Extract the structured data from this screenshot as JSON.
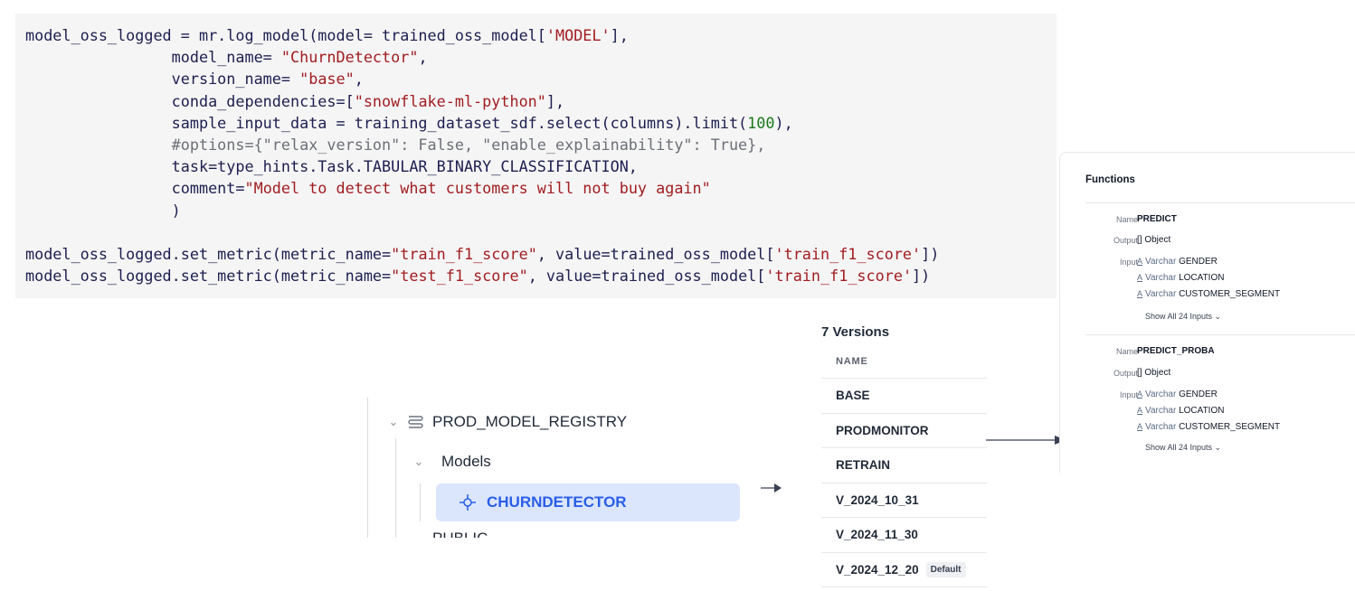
{
  "code": {
    "lines": [
      [
        [
          "plain",
          "model_oss_logged = mr.log_model(model= trained_oss_model["
        ],
        [
          "str",
          "'MODEL'"
        ],
        [
          "plain",
          "],"
        ]
      ],
      [
        [
          "plain",
          "                model_name= "
        ],
        [
          "str",
          "\"ChurnDetector\""
        ],
        [
          "plain",
          ","
        ]
      ],
      [
        [
          "plain",
          "                version_name= "
        ],
        [
          "str",
          "\"base\""
        ],
        [
          "plain",
          ","
        ]
      ],
      [
        [
          "plain",
          "                conda_dependencies=["
        ],
        [
          "str",
          "\"snowflake-ml-python\""
        ],
        [
          "plain",
          "],"
        ]
      ],
      [
        [
          "plain",
          "                sample_input_data = training_dataset_sdf.select(columns).limit("
        ],
        [
          "num",
          "100"
        ],
        [
          "plain",
          "),"
        ]
      ],
      [
        [
          "com",
          "                #options={\"relax_version\": False, \"enable_explainability\": True},"
        ]
      ],
      [
        [
          "plain",
          "                task=type_hints.Task.TABULAR_BINARY_CLASSIFICATION,"
        ]
      ],
      [
        [
          "plain",
          "                comment="
        ],
        [
          "str",
          "\"Model to detect what customers will not buy again\""
        ]
      ],
      [
        [
          "plain",
          "                )"
        ]
      ],
      [
        [
          "plain",
          ""
        ]
      ],
      [
        [
          "plain",
          "model_oss_logged.set_metric(metric_name="
        ],
        [
          "str",
          "\"train_f1_score\""
        ],
        [
          "plain",
          ", value=trained_oss_model["
        ],
        [
          "str",
          "'train_f1_score'"
        ],
        [
          "plain",
          "])"
        ]
      ],
      [
        [
          "plain",
          "model_oss_logged.set_metric(metric_name="
        ],
        [
          "str",
          "\"test_f1_score\""
        ],
        [
          "plain",
          ", value=trained_oss_model["
        ],
        [
          "str",
          "'train_f1_score'"
        ],
        [
          "plain",
          "])"
        ]
      ]
    ]
  },
  "tree": {
    "database": "PROD_MODEL_REGISTRY",
    "folder": "Models",
    "selected_model": "CHURNDETECTOR",
    "next_partial": "PUBLIC"
  },
  "versions": {
    "title": "7 Versions",
    "column_header": "NAME",
    "items": [
      {
        "name": "BASE"
      },
      {
        "name": "PRODMONITOR"
      },
      {
        "name": "RETRAIN"
      },
      {
        "name": "V_2024_10_31"
      },
      {
        "name": "V_2024_11_30"
      },
      {
        "name": "V_2024_12_20",
        "badge": "Default"
      }
    ]
  },
  "functions": {
    "title": "Functions",
    "labels": {
      "name": "Name",
      "output": "Output",
      "input": "Input"
    },
    "items": [
      {
        "name": "PREDICT",
        "output": "[] Object",
        "inputs": [
          {
            "type": "Varchar",
            "col": "GENDER"
          },
          {
            "type": "Varchar",
            "col": "LOCATION"
          },
          {
            "type": "Varchar",
            "col": "CUSTOMER_SEGMENT"
          }
        ],
        "show_all": "Show All 24 Inputs ⌄"
      },
      {
        "name": "PREDICT_PROBA",
        "output": "[] Object",
        "inputs": [
          {
            "type": "Varchar",
            "col": "GENDER"
          },
          {
            "type": "Varchar",
            "col": "LOCATION"
          },
          {
            "type": "Varchar",
            "col": "CUSTOMER_SEGMENT"
          }
        ],
        "show_all": "Show All 24 Inputs ⌄"
      }
    ]
  },
  "colors": {
    "selected_bg": "#dbe6fd",
    "selected_text": "#2a5ee8",
    "code_bg": "#f5f5f5",
    "string": "#a11d20",
    "number": "#1a7a1a"
  }
}
